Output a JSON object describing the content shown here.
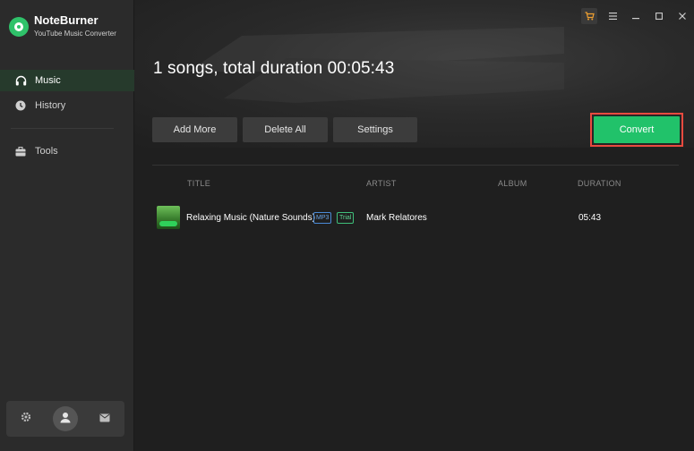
{
  "brand": {
    "name": "NoteBurner",
    "subtitle": "YouTube Music Converter"
  },
  "sidebar": {
    "items": [
      {
        "label": "Music",
        "icon": "headphones-icon",
        "active": true
      },
      {
        "label": "History",
        "icon": "clock-icon",
        "active": false
      },
      {
        "label": "Tools",
        "icon": "toolbox-icon",
        "active": false
      }
    ],
    "bottom": {
      "settings_icon": "gear-icon",
      "avatar_icon": "user-icon",
      "mail_icon": "mail-icon"
    }
  },
  "window_controls": {
    "cart_icon": "cart-icon",
    "menu_icon": "menu-icon",
    "minimize_icon": "minimize-icon",
    "maximize_icon": "maximize-icon",
    "close_icon": "close-icon"
  },
  "main": {
    "summary": "1 songs, total duration 00:05:43",
    "toolbar": {
      "add_more": "Add More",
      "delete_all": "Delete All",
      "settings": "Settings",
      "convert": "Convert"
    },
    "table": {
      "headers": {
        "title": "TITLE",
        "artist": "ARTIST",
        "album": "ALBUM",
        "duration": "DURATION"
      },
      "rows": [
        {
          "title": "Relaxing Music (Nature Sounds)",
          "format_badge": "MP3",
          "status_badge": "Trial",
          "artist": "Mark Relatores",
          "album": "",
          "duration": "05:43"
        }
      ]
    }
  },
  "colors": {
    "accent": "#21c26a",
    "highlight_border": "#e84a3f",
    "sidebar_bg": "#2b2b2b",
    "main_bg": "#1f1f1f"
  }
}
